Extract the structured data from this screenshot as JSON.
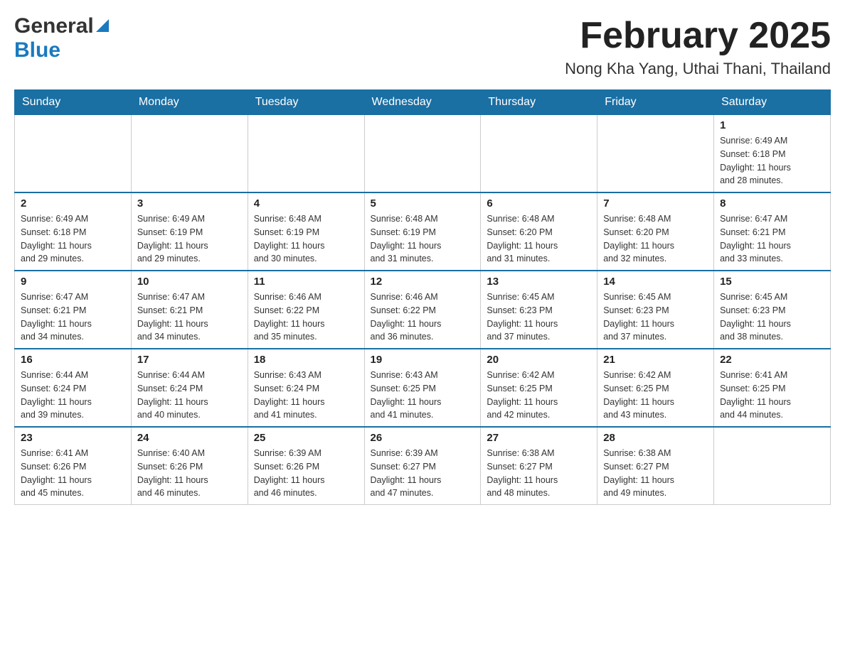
{
  "header": {
    "logo_general": "General",
    "logo_blue": "Blue",
    "month_title": "February 2025",
    "location": "Nong Kha Yang, Uthai Thani, Thailand"
  },
  "days_of_week": [
    "Sunday",
    "Monday",
    "Tuesday",
    "Wednesday",
    "Thursday",
    "Friday",
    "Saturday"
  ],
  "weeks": [
    {
      "days": [
        {
          "num": "",
          "info": ""
        },
        {
          "num": "",
          "info": ""
        },
        {
          "num": "",
          "info": ""
        },
        {
          "num": "",
          "info": ""
        },
        {
          "num": "",
          "info": ""
        },
        {
          "num": "",
          "info": ""
        },
        {
          "num": "1",
          "info": "Sunrise: 6:49 AM\nSunset: 6:18 PM\nDaylight: 11 hours\nand 28 minutes."
        }
      ]
    },
    {
      "days": [
        {
          "num": "2",
          "info": "Sunrise: 6:49 AM\nSunset: 6:18 PM\nDaylight: 11 hours\nand 29 minutes."
        },
        {
          "num": "3",
          "info": "Sunrise: 6:49 AM\nSunset: 6:19 PM\nDaylight: 11 hours\nand 29 minutes."
        },
        {
          "num": "4",
          "info": "Sunrise: 6:48 AM\nSunset: 6:19 PM\nDaylight: 11 hours\nand 30 minutes."
        },
        {
          "num": "5",
          "info": "Sunrise: 6:48 AM\nSunset: 6:19 PM\nDaylight: 11 hours\nand 31 minutes."
        },
        {
          "num": "6",
          "info": "Sunrise: 6:48 AM\nSunset: 6:20 PM\nDaylight: 11 hours\nand 31 minutes."
        },
        {
          "num": "7",
          "info": "Sunrise: 6:48 AM\nSunset: 6:20 PM\nDaylight: 11 hours\nand 32 minutes."
        },
        {
          "num": "8",
          "info": "Sunrise: 6:47 AM\nSunset: 6:21 PM\nDaylight: 11 hours\nand 33 minutes."
        }
      ]
    },
    {
      "days": [
        {
          "num": "9",
          "info": "Sunrise: 6:47 AM\nSunset: 6:21 PM\nDaylight: 11 hours\nand 34 minutes."
        },
        {
          "num": "10",
          "info": "Sunrise: 6:47 AM\nSunset: 6:21 PM\nDaylight: 11 hours\nand 34 minutes."
        },
        {
          "num": "11",
          "info": "Sunrise: 6:46 AM\nSunset: 6:22 PM\nDaylight: 11 hours\nand 35 minutes."
        },
        {
          "num": "12",
          "info": "Sunrise: 6:46 AM\nSunset: 6:22 PM\nDaylight: 11 hours\nand 36 minutes."
        },
        {
          "num": "13",
          "info": "Sunrise: 6:45 AM\nSunset: 6:23 PM\nDaylight: 11 hours\nand 37 minutes."
        },
        {
          "num": "14",
          "info": "Sunrise: 6:45 AM\nSunset: 6:23 PM\nDaylight: 11 hours\nand 37 minutes."
        },
        {
          "num": "15",
          "info": "Sunrise: 6:45 AM\nSunset: 6:23 PM\nDaylight: 11 hours\nand 38 minutes."
        }
      ]
    },
    {
      "days": [
        {
          "num": "16",
          "info": "Sunrise: 6:44 AM\nSunset: 6:24 PM\nDaylight: 11 hours\nand 39 minutes."
        },
        {
          "num": "17",
          "info": "Sunrise: 6:44 AM\nSunset: 6:24 PM\nDaylight: 11 hours\nand 40 minutes."
        },
        {
          "num": "18",
          "info": "Sunrise: 6:43 AM\nSunset: 6:24 PM\nDaylight: 11 hours\nand 41 minutes."
        },
        {
          "num": "19",
          "info": "Sunrise: 6:43 AM\nSunset: 6:25 PM\nDaylight: 11 hours\nand 41 minutes."
        },
        {
          "num": "20",
          "info": "Sunrise: 6:42 AM\nSunset: 6:25 PM\nDaylight: 11 hours\nand 42 minutes."
        },
        {
          "num": "21",
          "info": "Sunrise: 6:42 AM\nSunset: 6:25 PM\nDaylight: 11 hours\nand 43 minutes."
        },
        {
          "num": "22",
          "info": "Sunrise: 6:41 AM\nSunset: 6:25 PM\nDaylight: 11 hours\nand 44 minutes."
        }
      ]
    },
    {
      "days": [
        {
          "num": "23",
          "info": "Sunrise: 6:41 AM\nSunset: 6:26 PM\nDaylight: 11 hours\nand 45 minutes."
        },
        {
          "num": "24",
          "info": "Sunrise: 6:40 AM\nSunset: 6:26 PM\nDaylight: 11 hours\nand 46 minutes."
        },
        {
          "num": "25",
          "info": "Sunrise: 6:39 AM\nSunset: 6:26 PM\nDaylight: 11 hours\nand 46 minutes."
        },
        {
          "num": "26",
          "info": "Sunrise: 6:39 AM\nSunset: 6:27 PM\nDaylight: 11 hours\nand 47 minutes."
        },
        {
          "num": "27",
          "info": "Sunrise: 6:38 AM\nSunset: 6:27 PM\nDaylight: 11 hours\nand 48 minutes."
        },
        {
          "num": "28",
          "info": "Sunrise: 6:38 AM\nSunset: 6:27 PM\nDaylight: 11 hours\nand 49 minutes."
        },
        {
          "num": "",
          "info": ""
        }
      ]
    }
  ]
}
